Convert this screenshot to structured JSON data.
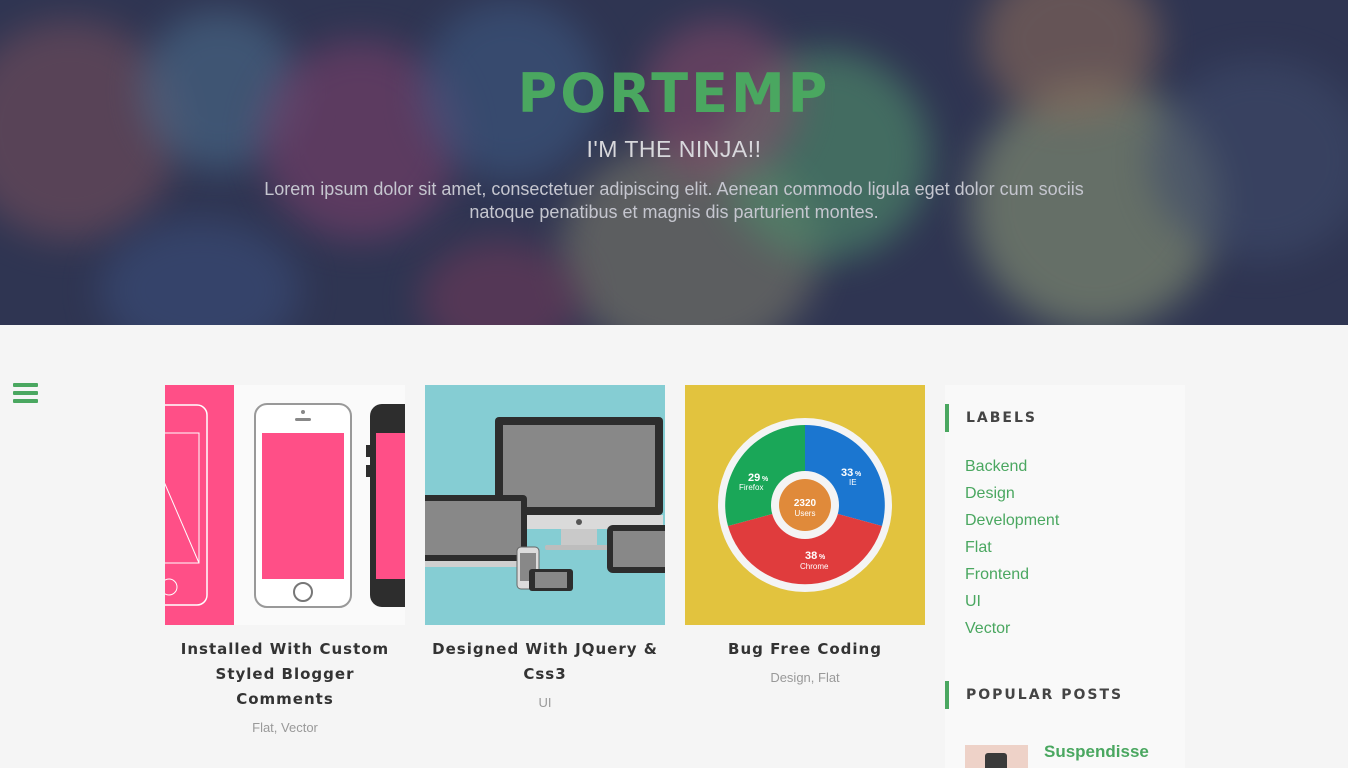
{
  "hero": {
    "title": "PORTEMP",
    "tagline": "I'M THE NINJA!!",
    "description": "Lorem ipsum dolor sit amet, consectetuer adipiscing elit. Aenean commodo ligula eget dolor cum sociis natoque penatibus et magnis dis parturient montes."
  },
  "colors": {
    "accent": "#4aa760",
    "hero_bg": "#2f3552",
    "page_bg": "#f5f5f5"
  },
  "nav": {
    "menu_icon": "hamburger-icon"
  },
  "posts": [
    {
      "title": "Installed With Custom Styled Blogger Comments",
      "tags": "Flat, Vector",
      "thumb_bg": "#ff4f87"
    },
    {
      "title": "Designed With JQuery & Css3",
      "tags": "UI",
      "thumb_bg": "#85cdd3"
    },
    {
      "title": "Bug Free Coding",
      "tags": "Design, Flat",
      "thumb_bg": "#e2c33e",
      "pie": {
        "center_value": "2320",
        "center_label": "Users",
        "slices": [
          {
            "value": "29",
            "unit": "%",
            "label": "Firefox",
            "color": "#1aa758"
          },
          {
            "value": "33",
            "unit": "%",
            "label": "IE",
            "color": "#1b76d0"
          },
          {
            "value": "38",
            "unit": "%",
            "label": "Chrome",
            "color": "#e03c3d"
          }
        ]
      }
    }
  ],
  "sidebar": {
    "labels_title": "LABELS",
    "labels": [
      "Backend",
      "Design",
      "Development",
      "Flat",
      "Frontend",
      "UI",
      "Vector"
    ],
    "popular_title": "POPULAR POSTS",
    "popular_posts": [
      {
        "title": "Suspendisse"
      }
    ]
  }
}
